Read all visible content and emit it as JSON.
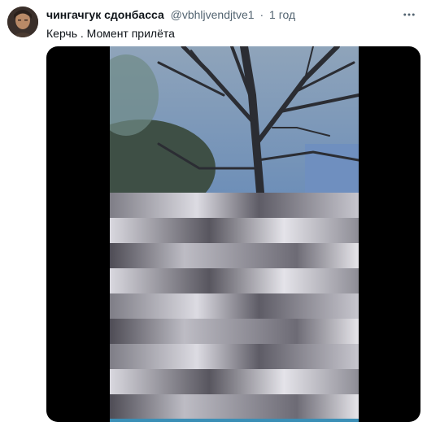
{
  "tweet": {
    "author_name": "чингачгук сдонбасса",
    "handle": "@vbhljvendjtve1",
    "separator": "·",
    "time": "1 год",
    "text": "Керчь . Момент прилёта"
  },
  "icons": {
    "more": "more-dots-icon",
    "avatar": "avatar"
  },
  "colors": {
    "text_primary": "#0f1419",
    "text_secondary": "#536471",
    "media_background": "#000000"
  }
}
